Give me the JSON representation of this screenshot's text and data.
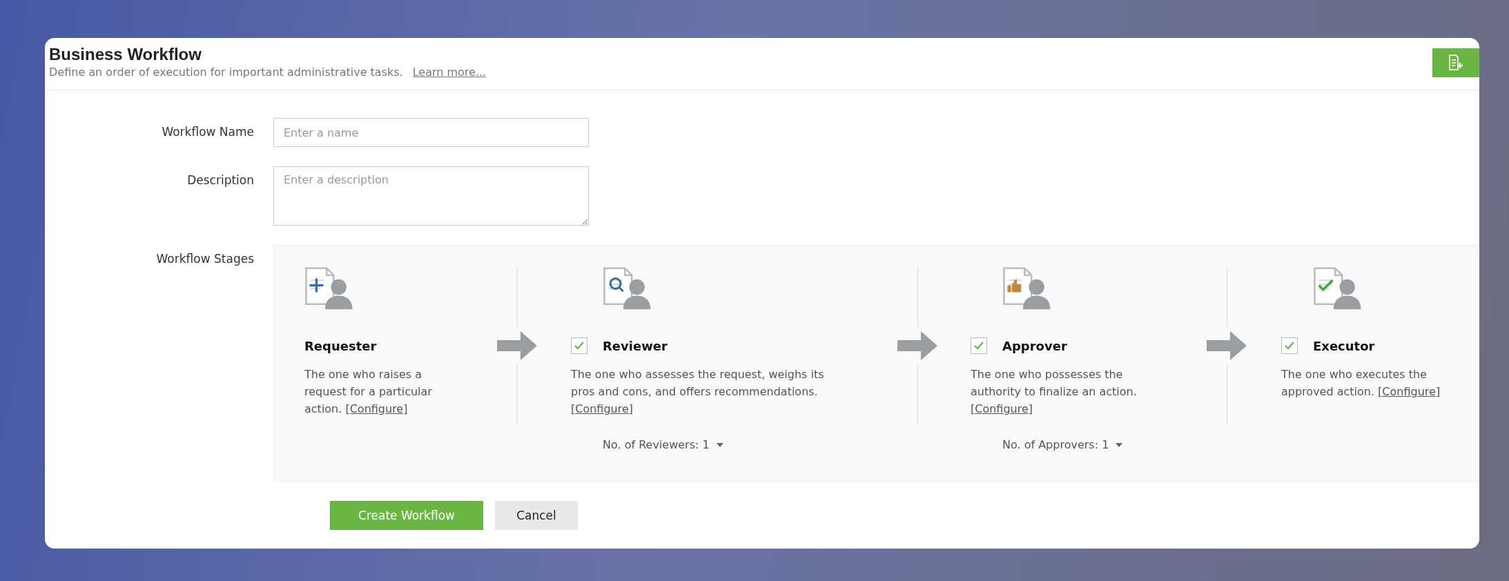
{
  "header": {
    "title": "Business Workflow",
    "subtitle": "Define an order of execution for important administrative tasks.",
    "link": "Learn more..."
  },
  "form": {
    "name_label": "Workflow Name",
    "name_placeholder": "Enter a name",
    "description_label": "Description",
    "description_placeholder": "Enter a description",
    "stages_label": "Workflow Stages"
  },
  "stages": [
    {
      "kind": "fixed",
      "title": "Requester",
      "description": "The one who raises a request for a particular action.",
      "link": "[Configure]"
    },
    {
      "kind": "optional",
      "checked": true,
      "title": "Reviewer",
      "description": "The one who assesses the request, weighs its pros and cons, and offers recommendations.",
      "link": "[Configure]",
      "count": "No. of Reviewers: 1"
    },
    {
      "kind": "optional",
      "checked": true,
      "title": "Approver",
      "description": "The one who possesses the authority to finalize an action.",
      "link": "[Configure]",
      "count": "No. of Approvers: 1"
    },
    {
      "kind": "optional",
      "checked": true,
      "title": "Executor",
      "description": "The one who executes the approved action.",
      "link": "[Configure]"
    }
  ],
  "buttons": {
    "primary": "Create Workflow",
    "secondary": "Cancel"
  }
}
